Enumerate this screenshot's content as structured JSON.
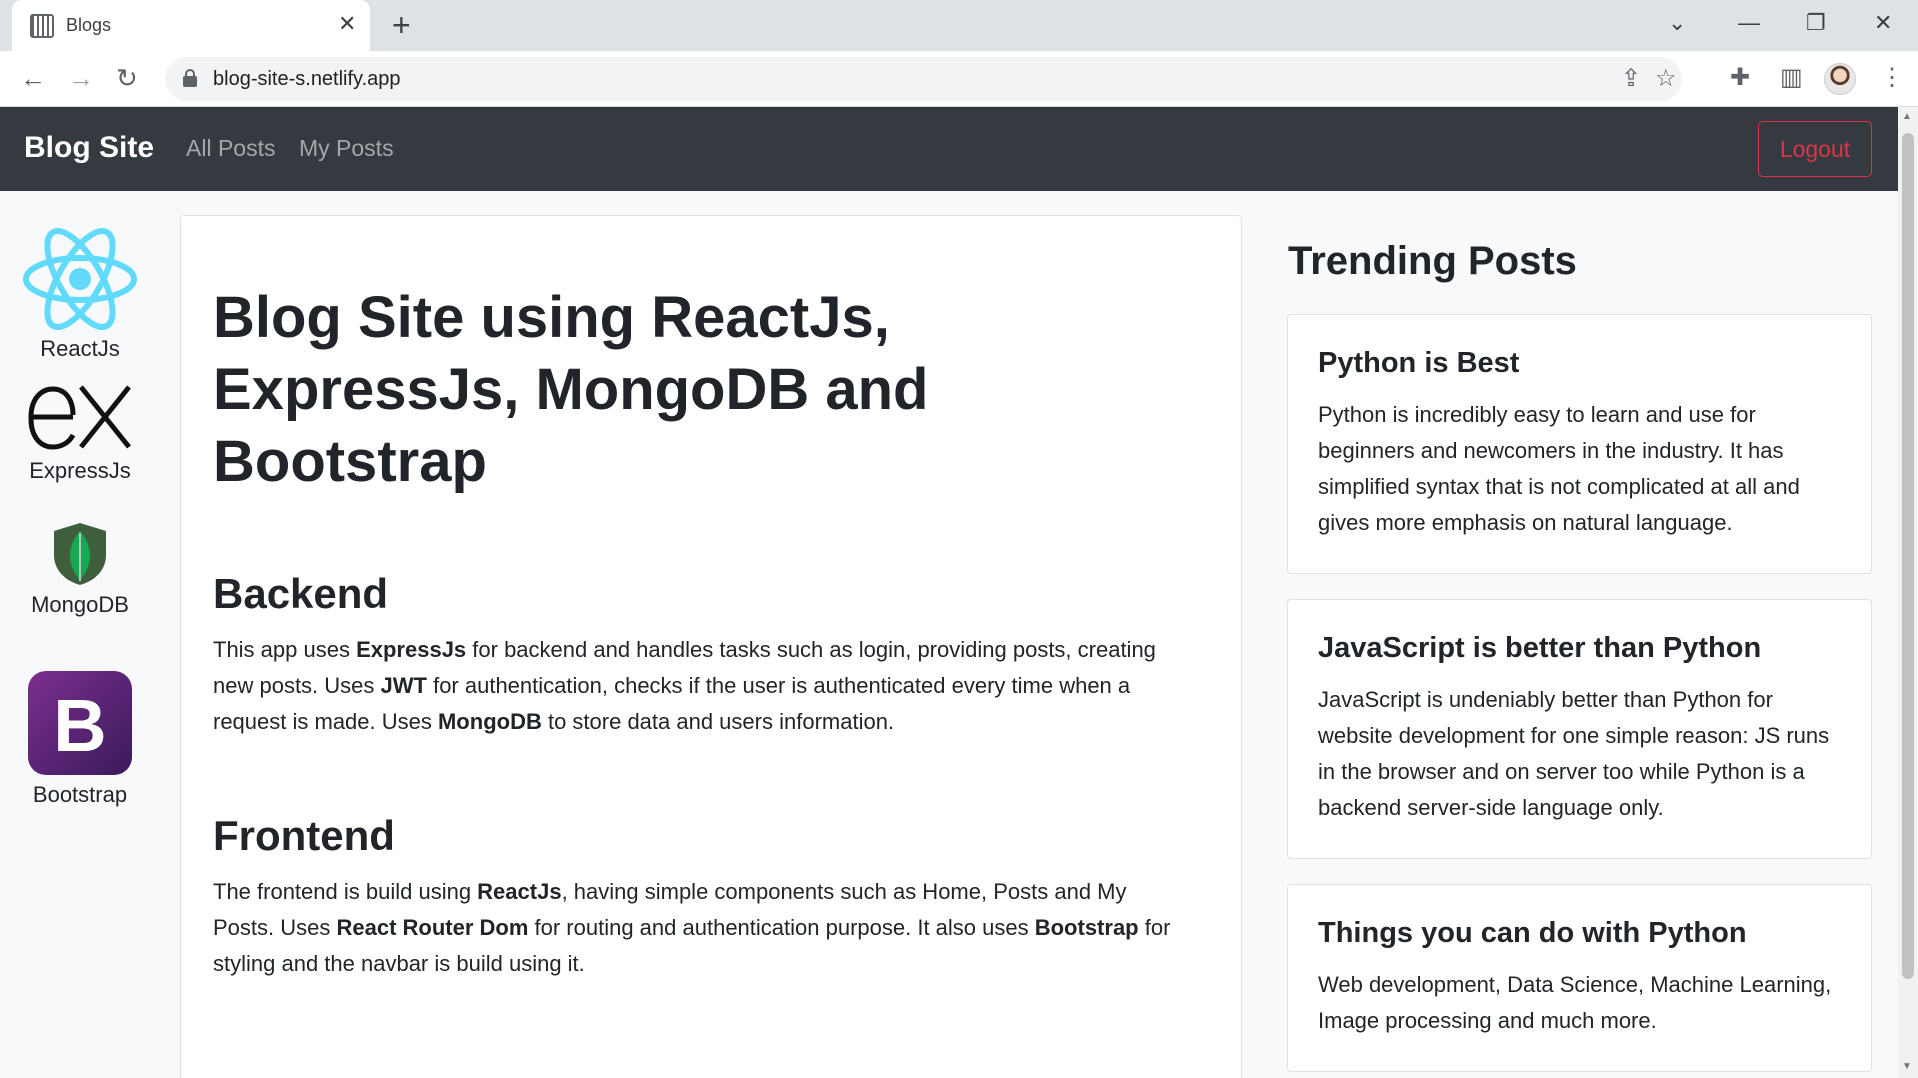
{
  "browser": {
    "tab_title": "Blogs",
    "url": "blog-site-s.netlify.app"
  },
  "navbar": {
    "brand": "Blog Site",
    "links": [
      "All Posts",
      "My Posts"
    ],
    "logout": "Logout"
  },
  "tech_logos": [
    {
      "label": "ReactJs",
      "icon": "react-icon"
    },
    {
      "label": "ExpressJs",
      "icon": "express-icon"
    },
    {
      "label": "MongoDB",
      "icon": "mongodb-icon"
    },
    {
      "label": "Bootstrap",
      "icon": "bootstrap-icon"
    }
  ],
  "main": {
    "title": "Blog Site using ReactJs, ExpressJs, MongoDB and Bootstrap",
    "sections": [
      {
        "heading": "Backend",
        "parts": [
          {
            "t": "This app uses "
          },
          {
            "t": "ExpressJs",
            "b": true
          },
          {
            "t": " for backend and handles tasks such as login, providing posts, creating new posts. Uses "
          },
          {
            "t": "JWT",
            "b": true
          },
          {
            "t": " for authentication, checks if the user is authenticated every time when a request is made. Uses "
          },
          {
            "t": "MongoDB",
            "b": true
          },
          {
            "t": " to store data and users information."
          }
        ]
      },
      {
        "heading": "Frontend",
        "parts": [
          {
            "t": "The frontend is build using "
          },
          {
            "t": "ReactJs",
            "b": true
          },
          {
            "t": ", having simple components such as Home, Posts and My Posts. Uses "
          },
          {
            "t": "React Router Dom",
            "b": true
          },
          {
            "t": " for routing and authentication purpose. It also uses "
          },
          {
            "t": "Bootstrap",
            "b": true
          },
          {
            "t": " for styling and the navbar is build using it."
          }
        ]
      }
    ]
  },
  "trending": {
    "heading": "Trending Posts",
    "posts": [
      {
        "title": "Python is Best",
        "text": "Python is incredibly easy to learn and use for beginners and newcomers in the industry. It has simplified syntax that is not complicated at all and gives more emphasis on natural language."
      },
      {
        "title": "JavaScript is better than Python",
        "text": "JavaScript is undeniably better than Python for website development for one simple reason: JS runs in the browser and on server too while Python is a backend server-side language only."
      },
      {
        "title": "Things you can do with Python",
        "text": "Web development, Data Science, Machine Learning, Image processing and much more."
      }
    ]
  },
  "colors": {
    "navbar_bg": "#343a40",
    "logout": "#dc3545",
    "react": "#61dafb",
    "mongodb": "#13aa52",
    "bootstrap": "#563d7c"
  }
}
